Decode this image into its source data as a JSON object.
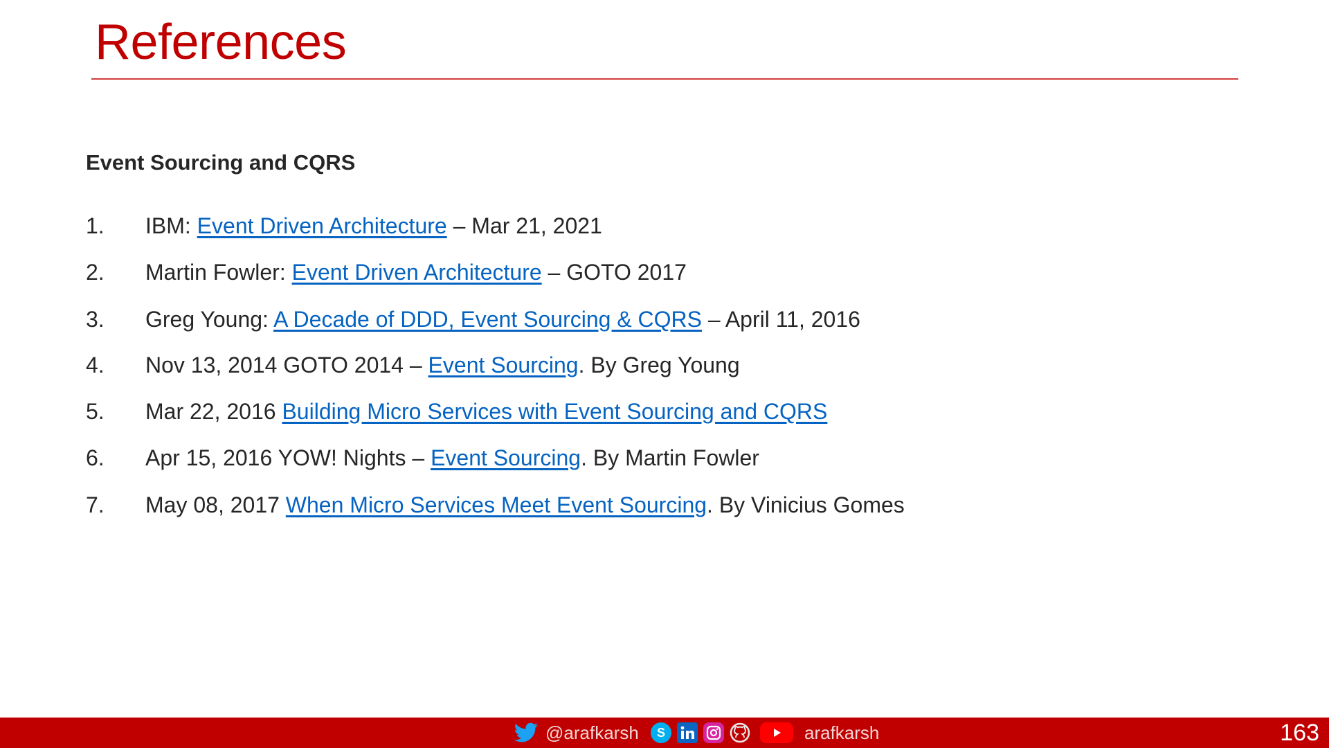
{
  "slide": {
    "title": "References",
    "section_heading": "Event Sourcing and CQRS",
    "page_number": "163"
  },
  "references": [
    {
      "num": "1.",
      "pre": "IBM: ",
      "link": "Event Driven Architecture",
      "post": " – Mar 21, 2021"
    },
    {
      "num": "2.",
      "pre": "Martin Fowler: ",
      "link": "Event Driven Architecture",
      "post": " – GOTO 2017"
    },
    {
      "num": "3.",
      "pre": "Greg Young: ",
      "link": "A Decade of DDD, Event Sourcing & CQRS",
      "post": " – April 11, 2016"
    },
    {
      "num": "4.",
      "pre": "Nov 13, 2014 GOTO 2014 – ",
      "link": "Event Sourcing",
      "post": ". By Greg Young"
    },
    {
      "num": "5.",
      "pre": "Mar 22, 2016 ",
      "link": "Building Micro Services with Event Sourcing and CQRS",
      "post": ""
    },
    {
      "num": "6.",
      "pre": "Apr 15, 2016 YOW! Nights – ",
      "link": "Event Sourcing",
      "post": ". By Martin Fowler"
    },
    {
      "num": "7.",
      "pre": "May 08, 2017 ",
      "link": "When Micro Services Meet Event Sourcing",
      "post": ". By Vinicius Gomes"
    }
  ],
  "footer": {
    "twitter_handle": "@arafkarsh",
    "channel_handle": "arafkarsh",
    "icons": [
      "twitter-icon",
      "skype-icon",
      "linkedin-icon",
      "instagram-icon",
      "github-icon",
      "youtube-icon"
    ]
  },
  "colors": {
    "accent": "#c00000",
    "link": "#0563c1",
    "text": "#262626"
  }
}
